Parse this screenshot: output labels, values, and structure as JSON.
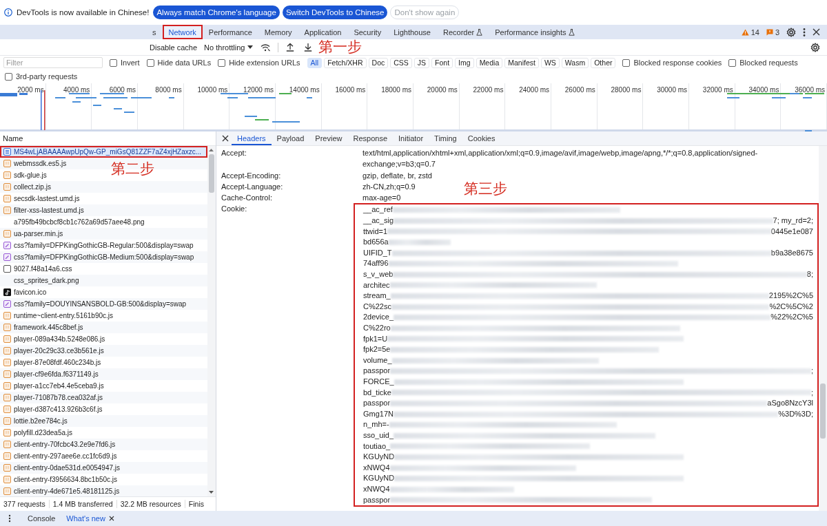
{
  "infobar": {
    "message": "DevTools is now available in Chinese!",
    "buttons": [
      {
        "label": "Always match Chrome's language",
        "kind": "primary"
      },
      {
        "label": "Switch DevTools to Chinese",
        "kind": "primary"
      },
      {
        "label": "Don't show again",
        "kind": "secondary"
      }
    ]
  },
  "panel_tabs": [
    {
      "label": "s",
      "selected": false,
      "experimental": false,
      "annotated": false
    },
    {
      "label": "Network",
      "selected": true,
      "experimental": false,
      "annotated": true
    },
    {
      "label": "Performance",
      "selected": false,
      "experimental": false,
      "annotated": false
    },
    {
      "label": "Memory",
      "selected": false,
      "experimental": false,
      "annotated": false
    },
    {
      "label": "Application",
      "selected": false,
      "experimental": false,
      "annotated": false
    },
    {
      "label": "Security",
      "selected": false,
      "experimental": false,
      "annotated": false
    },
    {
      "label": "Lighthouse",
      "selected": false,
      "experimental": false,
      "annotated": false
    },
    {
      "label": "Recorder",
      "selected": false,
      "experimental": true,
      "annotated": false
    },
    {
      "label": "Performance insights",
      "selected": false,
      "experimental": true,
      "annotated": false
    }
  ],
  "counters": {
    "warnings": "14",
    "issues": "3"
  },
  "toolbar": {
    "disable_cache": "Disable cache",
    "throttling": "No throttling"
  },
  "filter": {
    "placeholder": "Filter",
    "options": [
      {
        "label": "Invert",
        "checked": false
      },
      {
        "label": "Hide data URLs",
        "checked": false
      },
      {
        "label": "Hide extension URLs",
        "checked": false
      }
    ],
    "types": [
      {
        "label": "All",
        "selected": true
      },
      {
        "label": "Fetch/XHR",
        "selected": false
      },
      {
        "label": "Doc",
        "selected": false
      },
      {
        "label": "CSS",
        "selected": false
      },
      {
        "label": "JS",
        "selected": false
      },
      {
        "label": "Font",
        "selected": false
      },
      {
        "label": "Img",
        "selected": false
      },
      {
        "label": "Media",
        "selected": false
      },
      {
        "label": "Manifest",
        "selected": false
      },
      {
        "label": "WS",
        "selected": false
      },
      {
        "label": "Wasm",
        "selected": false
      },
      {
        "label": "Other",
        "selected": false
      }
    ],
    "blocked": [
      {
        "label": "Blocked response cookies",
        "checked": false
      },
      {
        "label": "Blocked requests",
        "checked": false
      }
    ],
    "third_party": {
      "label": "3rd-party requests",
      "checked": false
    }
  },
  "overview": {
    "ticks": [
      "2000 ms",
      "4000 ms",
      "6000 ms",
      "8000 ms",
      "10000 ms",
      "12000 ms",
      "14000 ms",
      "16000 ms",
      "18000 ms",
      "20000 ms",
      "22000 ms",
      "24000 ms",
      "26000 ms",
      "28000 ms",
      "30000 ms",
      "32000 ms",
      "34000 ms",
      "36000 ms"
    ]
  },
  "requests": {
    "column": "Name",
    "rows": [
      {
        "name": "MS4wLjABAAAAwpUpQw-GP_miGsQ81ZZF7aZ4xjHZaxzc...",
        "kind": "document",
        "selected": true,
        "annotated": true
      },
      {
        "name": "webmssdk.es5.js",
        "kind": "script",
        "selected": false,
        "annotated": false
      },
      {
        "name": "sdk-glue.js",
        "kind": "script",
        "selected": false,
        "annotated": false
      },
      {
        "name": "collect.zip.js",
        "kind": "script",
        "selected": false,
        "annotated": false
      },
      {
        "name": "secsdk-lastest.umd.js",
        "kind": "script",
        "selected": false,
        "annotated": false
      },
      {
        "name": "filter-xss-lastest.umd.js",
        "kind": "script",
        "selected": false,
        "annotated": false
      },
      {
        "name": "a795fb49bcbcf8cb1c762a69d57aee48.png",
        "kind": "image",
        "selected": false,
        "annotated": false
      },
      {
        "name": "ua-parser.min.js",
        "kind": "script",
        "selected": false,
        "annotated": false
      },
      {
        "name": "css?family=DFPKingGothicGB-Regular:500&display=swap",
        "kind": "font",
        "selected": false,
        "annotated": false
      },
      {
        "name": "css?family=DFPKingGothicGB-Medium:500&display=swap",
        "kind": "font",
        "selected": false,
        "annotated": false
      },
      {
        "name": "9027.f48a14a6.css",
        "kind": "stylesheet",
        "selected": false,
        "annotated": false
      },
      {
        "name": "css_sprites_dark.png",
        "kind": "image",
        "selected": false,
        "annotated": false
      },
      {
        "name": "favicon.ico",
        "kind": "favicon",
        "selected": false,
        "annotated": false
      },
      {
        "name": "css?family=DOUYINSANSBOLD-GB:500&display=swap",
        "kind": "font",
        "selected": false,
        "annotated": false
      },
      {
        "name": "runtime~client-entry.5161b90c.js",
        "kind": "script",
        "selected": false,
        "annotated": false
      },
      {
        "name": "framework.445c8bef.js",
        "kind": "script",
        "selected": false,
        "annotated": false
      },
      {
        "name": "player-089a434b.5248e086.js",
        "kind": "script",
        "selected": false,
        "annotated": false
      },
      {
        "name": "player-20c29c33.ce3b561e.js",
        "kind": "script",
        "selected": false,
        "annotated": false
      },
      {
        "name": "player-87e08fdf.460c234b.js",
        "kind": "script",
        "selected": false,
        "annotated": false
      },
      {
        "name": "player-cf9e6fda.f6371149.js",
        "kind": "script",
        "selected": false,
        "annotated": false
      },
      {
        "name": "player-a1cc7eb4.4e5ceba9.js",
        "kind": "script",
        "selected": false,
        "annotated": false
      },
      {
        "name": "player-71087b78.cea032af.js",
        "kind": "script",
        "selected": false,
        "annotated": false
      },
      {
        "name": "player-d387c413.926b3c6f.js",
        "kind": "script",
        "selected": false,
        "annotated": false
      },
      {
        "name": "lottie.b2ee784c.js",
        "kind": "script",
        "selected": false,
        "annotated": false
      },
      {
        "name": "polyfill.d23dea5a.js",
        "kind": "script",
        "selected": false,
        "annotated": false
      },
      {
        "name": "client-entry-70fcbc43.2e9e7fd6.js",
        "kind": "script",
        "selected": false,
        "annotated": false
      },
      {
        "name": "client-entry-297aee6e.cc1fc6d9.js",
        "kind": "script",
        "selected": false,
        "annotated": false
      },
      {
        "name": "client-entry-0dae531d.e0054947.js",
        "kind": "script",
        "selected": false,
        "annotated": false
      },
      {
        "name": "client-entry-f3956634.8bc1b50c.js",
        "kind": "script",
        "selected": false,
        "annotated": false
      },
      {
        "name": "client-entry-4de671e5.48181125.js",
        "kind": "script",
        "selected": false,
        "annotated": false
      }
    ]
  },
  "status_bar": [
    "377 requests",
    "1.4 MB transferred",
    "32.2 MB resources",
    "Finis"
  ],
  "detail": {
    "tabs": [
      {
        "label": "Headers",
        "selected": true
      },
      {
        "label": "Payload",
        "selected": false
      },
      {
        "label": "Preview",
        "selected": false
      },
      {
        "label": "Response",
        "selected": false
      },
      {
        "label": "Initiator",
        "selected": false
      },
      {
        "label": "Timing",
        "selected": false
      },
      {
        "label": "Cookies",
        "selected": false
      }
    ],
    "headers": [
      {
        "name": "Accept:",
        "value": "text/html,application/xhtml+xml,application/xml;q=0.9,image/avif,image/webp,image/apng,*/*;q=0.8,application/signed-exchange;v=b3;q=0.7"
      },
      {
        "name": "Accept-Encoding:",
        "value": "gzip, deflate, br, zstd"
      },
      {
        "name": "Accept-Language:",
        "value": "zh-CN,zh;q=0.9"
      },
      {
        "name": "Cache-Control:",
        "value": "max-age=0"
      }
    ],
    "cookie": {
      "name": "Cookie:",
      "annotated": true,
      "lines": [
        {
          "start": "__ac_ref"
        },
        {
          "start": "__ac_sig",
          "end": "7; my_rd=2;"
        },
        {
          "start": "ttwid=1",
          "end": "0445e1e087"
        },
        {
          "start": "bd656a"
        },
        {
          "start": "UIFID_T",
          "end": "b9a38e8675"
        },
        {
          "start": "74aff96"
        },
        {
          "start": "s_v_web",
          "end": "8;"
        },
        {
          "start": "architec"
        },
        {
          "start": "stream_",
          "end": "2195%2C%5"
        },
        {
          "start": "C%22sc",
          "end": "%2C%5C%2"
        },
        {
          "start": "2device_",
          "end": "%22%2C%5"
        },
        {
          "start": "C%22ro"
        },
        {
          "start": "fpk1=U"
        },
        {
          "start": "fpk2=5e"
        },
        {
          "start": "volume_"
        },
        {
          "start": "passpor",
          "end": ";"
        },
        {
          "start": "FORCE_"
        },
        {
          "start": "bd_ticke",
          "end": ";"
        },
        {
          "start": "passpor",
          "end": "aSgo8NzcY3l"
        },
        {
          "start": "Gmg17N",
          "end": "%3D%3D;"
        },
        {
          "start": "n_mh=-"
        },
        {
          "start": "sso_uid_"
        },
        {
          "start": "toutiao_"
        },
        {
          "start": "KGUyND"
        },
        {
          "start": "xNWQ4"
        },
        {
          "start": "KGUyND"
        },
        {
          "start": "xNWQ4"
        },
        {
          "start": "passpor"
        }
      ]
    }
  },
  "drawer": {
    "tabs": [
      {
        "label": "Console",
        "selected": false
      },
      {
        "label": "What's new",
        "selected": true
      }
    ]
  },
  "annotations": [
    {
      "text": "第一步"
    },
    {
      "text": "第二步"
    },
    {
      "text": "第三步"
    }
  ]
}
